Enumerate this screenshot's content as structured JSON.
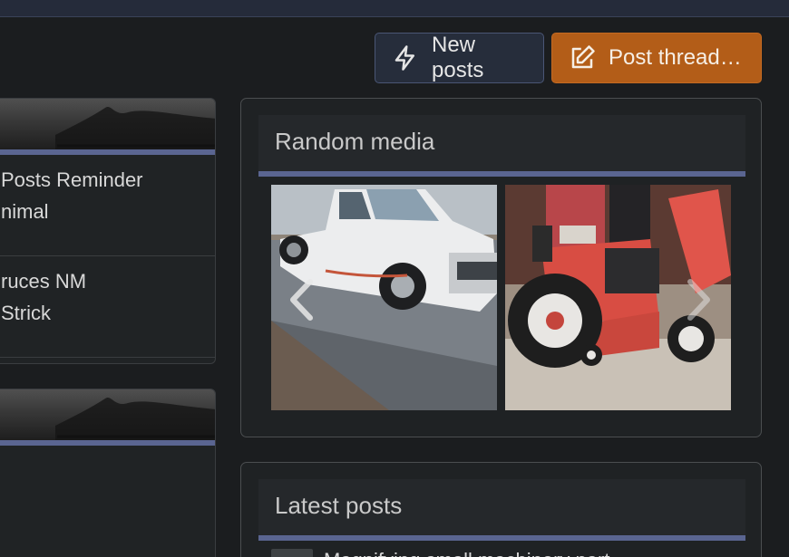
{
  "actions": {
    "new_posts": "New posts",
    "post_thread": "Post thread…"
  },
  "sidebar": {
    "block1_items": [
      {
        "line1": "Posts Reminder",
        "line2": "nimal"
      },
      {
        "line1": "ruces NM",
        "line2": " Strick"
      }
    ]
  },
  "random_media": {
    "title": "Random media",
    "items": [
      {
        "icon": "white-pickup-truck-photo"
      },
      {
        "icon": "red-tractor-photo"
      }
    ]
  },
  "latest_posts": {
    "title": "Latest posts",
    "first_item_text": "Magnifying small machinery part"
  }
}
